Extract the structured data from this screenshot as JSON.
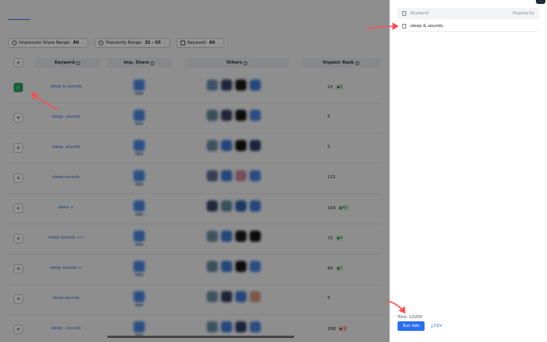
{
  "filters": [
    {
      "label": "Impression Share Range:",
      "value": "All"
    },
    {
      "label": "Popularity Range:",
      "value": "31 - 55"
    },
    {
      "label": "Keyword:",
      "value": "All"
    }
  ],
  "headers": {
    "add": "+",
    "keyword": "Keyword",
    "imp_share": "Imp. Share",
    "others": "Others",
    "organic_rank": "Organic Rank"
  },
  "rows": [
    {
      "keyword": "sleep & sounds",
      "checked": true,
      "rank": "23",
      "change": "3",
      "dir": "up",
      "apps": [
        "#6b8fb0",
        "#39426a",
        "#1a1a1a",
        "#3f7ad6"
      ]
    },
    {
      "keyword": "sleep: sounds",
      "checked": false,
      "rank": "5",
      "change": "",
      "dir": "",
      "apps": [
        "#5f8a9a",
        "#3a3f63",
        "#141414",
        "#4a86df"
      ]
    },
    {
      "keyword": "sleep. sounds",
      "checked": false,
      "rank": "5",
      "change": "",
      "dir": "",
      "apps": [
        "#6e8fa6",
        "#3f7ad6",
        "#151515",
        "#2f3f66"
      ]
    },
    {
      "keyword": "sleep-sounds",
      "checked": false,
      "rank": "121",
      "change": "",
      "dir": "",
      "apps": [
        "#5d6f8e",
        "#3f7ad6",
        "#c9889a",
        "#4a86df"
      ]
    },
    {
      "keyword": "sleep +",
      "checked": false,
      "rank": "169",
      "change": "42",
      "dir": "up",
      "apps": [
        "#3b4566",
        "#5d8aa0",
        "#2f5fb0",
        "#3f7ad6"
      ]
    },
    {
      "keyword": "sleep sounds ++",
      "checked": false,
      "rank": "72",
      "change": "4",
      "dir": "up",
      "apps": [
        "#6a8f9f",
        "#3f7ad6",
        "#1a1a1a",
        "#151515"
      ]
    },
    {
      "keyword": "sleep sounds +",
      "checked": false,
      "rank": "84",
      "change": "7",
      "dir": "up",
      "apps": [
        "#5f8a9a",
        "#3f7ad6",
        "#161616",
        "#4a86df"
      ]
    },
    {
      "keyword": "sleep sounds",
      "checked": false,
      "rank": "5",
      "change": "",
      "dir": "",
      "apps": [
        "#6a8fa6",
        "#3a3f63",
        "#3f7ad6",
        "#d49a7e"
      ]
    },
    {
      "keyword": "sleep . sounds",
      "checked": false,
      "rank": "188",
      "change": "-3",
      "dir": "down",
      "apps": [
        "#6a8fa6",
        "#3f7ad6",
        "#2f3f66",
        "#4a86df"
      ]
    }
  ],
  "panel": {
    "col_keyword": "Keyword",
    "col_popularity": "Popularity",
    "selected": [
      {
        "keyword": "sleep & sounds"
      }
    ],
    "total": "Total: 1/1000",
    "run_button": "Run Ads",
    "csv_label": "CSV"
  },
  "colors": {
    "accent": "#2a6ef0",
    "check_green": "#2fa866",
    "arrow_red": "#ff4d4f"
  }
}
